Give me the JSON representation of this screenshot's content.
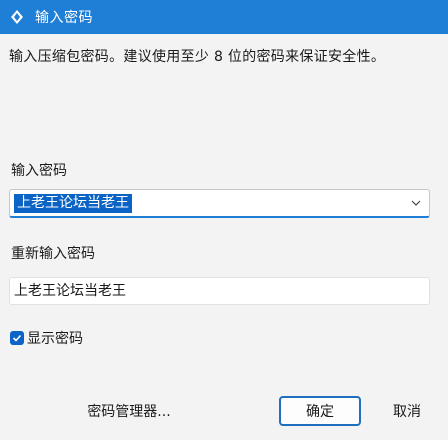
{
  "window": {
    "title": "输入密码",
    "accent": "#1f7ed6"
  },
  "description": "输入压缩包密码。建议使用至少 8 位的密码来保证安全性。",
  "password": {
    "label": "输入密码",
    "value": "上老王论坛当老王"
  },
  "confirm_password": {
    "label": "重新输入密码",
    "value": "上老王论坛当老王"
  },
  "show_password": {
    "label": "显示密码",
    "checked": true
  },
  "buttons": {
    "manager": "密码管理器...",
    "ok": "确定",
    "cancel": "取消"
  }
}
